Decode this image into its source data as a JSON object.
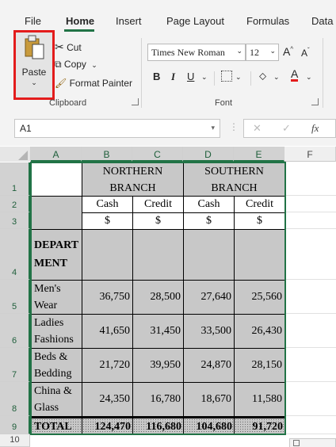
{
  "ribbon_tabs": [
    "File",
    "Home",
    "Insert",
    "Page Layout",
    "Formulas",
    "Data"
  ],
  "clipboard": {
    "paste": "Paste",
    "cut": "Cut",
    "copy": "Copy",
    "format_painter": "Format Painter",
    "group_label": "Clipboard"
  },
  "font": {
    "name": "Times New Roman",
    "size": "12",
    "grow": "A",
    "shrink": "A",
    "bold": "B",
    "italic": "I",
    "underline": "U",
    "font_color": "A",
    "group_label": "Font"
  },
  "name_box": "A1",
  "formula_icons": {
    "cancel": "✕",
    "enter": "✓",
    "fx": "fx"
  },
  "columns": [
    "A",
    "B",
    "C",
    "D",
    "E",
    "F"
  ],
  "rows": [
    "1",
    "2",
    "3",
    "4",
    "5",
    "6",
    "7",
    "8",
    "9",
    "10"
  ],
  "sheet": {
    "northern": "NORTHERN BRANCH",
    "southern": "SOUTHERN BRANCH",
    "cash": "Cash",
    "credit": "Credit",
    "currency": "$",
    "department": "DEPARTMENT",
    "departments": [
      {
        "name": "Men's Wear",
        "n_cash": "36,750",
        "n_credit": "28,500",
        "s_cash": "27,640",
        "s_credit": "25,560"
      },
      {
        "name": "Ladies Fashions",
        "n_cash": "41,650",
        "n_credit": "31,450",
        "s_cash": "33,500",
        "s_credit": "26,430"
      },
      {
        "name": "Beds & Bedding",
        "n_cash": "21,720",
        "n_credit": "39,950",
        "s_cash": "24,870",
        "s_credit": "28,150"
      },
      {
        "name": "China & Glass",
        "n_cash": "24,350",
        "n_credit": "16,780",
        "s_cash": "18,670",
        "s_credit": "11,580"
      }
    ],
    "total": {
      "label": "TOTAL",
      "n_cash": "124,470",
      "n_credit": "116,680",
      "s_cash": "104,680",
      "s_credit": "91,720"
    }
  },
  "colors": {
    "accent": "#217346",
    "highlight_border": "#e31c1c",
    "cell_fill": "#c8c8c8"
  }
}
